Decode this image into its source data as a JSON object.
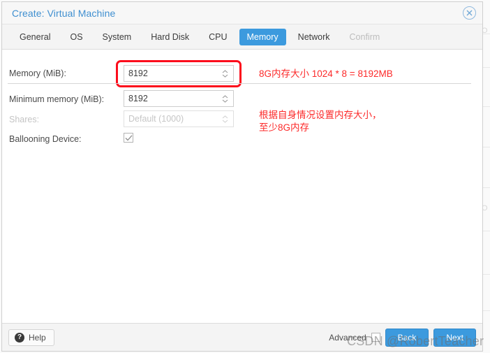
{
  "window": {
    "title": "Create: Virtual Machine",
    "close_icon": "close-circle-icon"
  },
  "tabs": [
    {
      "label": "General",
      "state": "normal"
    },
    {
      "label": "OS",
      "state": "normal"
    },
    {
      "label": "System",
      "state": "normal"
    },
    {
      "label": "Hard Disk",
      "state": "normal"
    },
    {
      "label": "CPU",
      "state": "normal"
    },
    {
      "label": "Memory",
      "state": "active"
    },
    {
      "label": "Network",
      "state": "normal"
    },
    {
      "label": "Confirm",
      "state": "disabled"
    }
  ],
  "form": {
    "memory": {
      "label": "Memory (MiB):",
      "value": "8192",
      "placeholder": ""
    },
    "minimum_memory": {
      "label": "Minimum memory (MiB):",
      "value": "8192",
      "placeholder": ""
    },
    "shares": {
      "label": "Shares:",
      "value": "",
      "placeholder": "Default (1000)"
    },
    "ballooning": {
      "label": "Ballooning Device:",
      "checked": true,
      "check_glyph": "✓"
    }
  },
  "annotations": {
    "memory_note": "8G内存大小 1024 * 8 = 8192MB",
    "shares_note": "根据自身情况设置内存大小，\n至少8G内存"
  },
  "footer": {
    "help_label": "Help",
    "help_icon_glyph": "?",
    "advanced_label": "Advanced",
    "advanced_checked": false,
    "back_label": "Back",
    "next_label": "Next"
  },
  "watermark": {
    "text": "CSDN @RobertTeacher"
  },
  "colors": {
    "accent": "#3c9ade",
    "title": "#3f8fd0",
    "annotation_red": "#fc2a2a",
    "callout_red": "#fc0d1c"
  }
}
